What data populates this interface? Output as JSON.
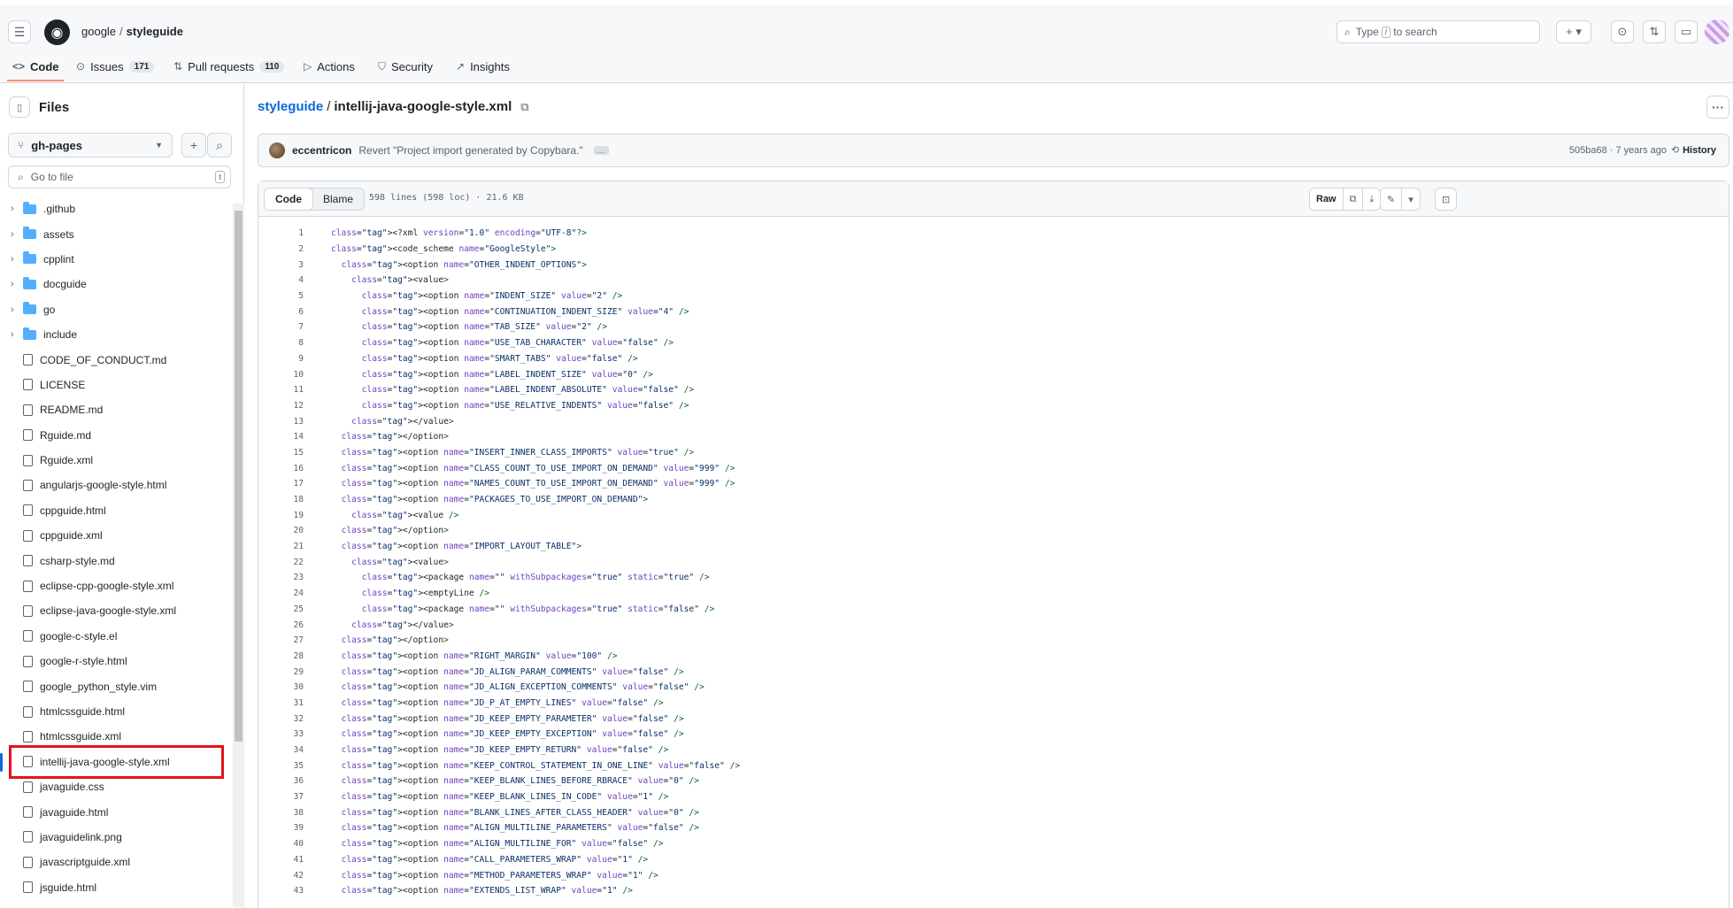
{
  "header": {
    "owner": "google",
    "repo": "styleguide",
    "search_prefix": "Type",
    "search_kbd": "/",
    "search_suffix": "to search"
  },
  "nav_tabs": [
    {
      "icon": "code-icon",
      "label": "Code",
      "count": ""
    },
    {
      "icon": "issue-icon",
      "label": "Issues",
      "count": "171"
    },
    {
      "icon": "pull-request-icon",
      "label": "Pull requests",
      "count": "110"
    },
    {
      "icon": "actions-icon",
      "label": "Actions",
      "count": ""
    },
    {
      "icon": "shield-icon",
      "label": "Security",
      "count": ""
    },
    {
      "icon": "graph-icon",
      "label": "Insights",
      "count": ""
    }
  ],
  "sidebar": {
    "title": "Files",
    "branch": "gh-pages",
    "goto_placeholder": "Go to file",
    "goto_kbd": "t",
    "items": [
      {
        "type": "folder",
        "name": ".github"
      },
      {
        "type": "folder",
        "name": "assets"
      },
      {
        "type": "folder",
        "name": "cpplint"
      },
      {
        "type": "folder",
        "name": "docguide"
      },
      {
        "type": "folder",
        "name": "go"
      },
      {
        "type": "folder",
        "name": "include"
      },
      {
        "type": "file",
        "name": "CODE_OF_CONDUCT.md"
      },
      {
        "type": "file",
        "name": "LICENSE"
      },
      {
        "type": "file",
        "name": "README.md"
      },
      {
        "type": "file",
        "name": "Rguide.md"
      },
      {
        "type": "file",
        "name": "Rguide.xml"
      },
      {
        "type": "file",
        "name": "angularjs-google-style.html"
      },
      {
        "type": "file",
        "name": "cppguide.html"
      },
      {
        "type": "file",
        "name": "cppguide.xml"
      },
      {
        "type": "file",
        "name": "csharp-style.md"
      },
      {
        "type": "file",
        "name": "eclipse-cpp-google-style.xml"
      },
      {
        "type": "file",
        "name": "eclipse-java-google-style.xml"
      },
      {
        "type": "file",
        "name": "google-c-style.el"
      },
      {
        "type": "file",
        "name": "google-r-style.html"
      },
      {
        "type": "file",
        "name": "google_python_style.vim"
      },
      {
        "type": "file",
        "name": "htmlcssguide.html"
      },
      {
        "type": "file",
        "name": "htmlcssguide.xml"
      },
      {
        "type": "file",
        "name": "intellij-java-google-style.xml",
        "selected": true
      },
      {
        "type": "file",
        "name": "javaguide.css"
      },
      {
        "type": "file",
        "name": "javaguide.html"
      },
      {
        "type": "file",
        "name": "javaguidelink.png"
      },
      {
        "type": "file",
        "name": "javascriptguide.xml"
      },
      {
        "type": "file",
        "name": "jsguide.html"
      }
    ]
  },
  "breadcrumb": {
    "repo_link": "styleguide",
    "separator": "/",
    "file": "intellij-java-google-style.xml"
  },
  "commit": {
    "author": "eccentricon",
    "message": "Revert \"Project import generated by Copybara.\"",
    "ellipsis": "…",
    "meta": "505ba68 · 7 years ago",
    "history_label": "History"
  },
  "code_toolbar": {
    "code_label": "Code",
    "blame_label": "Blame",
    "info": "598 lines (598 loc) · 21.6 KB",
    "raw_label": "Raw"
  },
  "code_lines": [
    "<?xml version=\"1.0\" encoding=\"UTF-8\"?>",
    "<code_scheme name=\"GoogleStyle\">",
    "  <option name=\"OTHER_INDENT_OPTIONS\">",
    "    <value>",
    "      <option name=\"INDENT_SIZE\" value=\"2\" />",
    "      <option name=\"CONTINUATION_INDENT_SIZE\" value=\"4\" />",
    "      <option name=\"TAB_SIZE\" value=\"2\" />",
    "      <option name=\"USE_TAB_CHARACTER\" value=\"false\" />",
    "      <option name=\"SMART_TABS\" value=\"false\" />",
    "      <option name=\"LABEL_INDENT_SIZE\" value=\"0\" />",
    "      <option name=\"LABEL_INDENT_ABSOLUTE\" value=\"false\" />",
    "      <option name=\"USE_RELATIVE_INDENTS\" value=\"false\" />",
    "    </value>",
    "  </option>",
    "  <option name=\"INSERT_INNER_CLASS_IMPORTS\" value=\"true\" />",
    "  <option name=\"CLASS_COUNT_TO_USE_IMPORT_ON_DEMAND\" value=\"999\" />",
    "  <option name=\"NAMES_COUNT_TO_USE_IMPORT_ON_DEMAND\" value=\"999\" />",
    "  <option name=\"PACKAGES_TO_USE_IMPORT_ON_DEMAND\">",
    "    <value />",
    "  </option>",
    "  <option name=\"IMPORT_LAYOUT_TABLE\">",
    "    <value>",
    "      <package name=\"\" withSubpackages=\"true\" static=\"true\" />",
    "      <emptyLine />",
    "      <package name=\"\" withSubpackages=\"true\" static=\"false\" />",
    "    </value>",
    "  </option>",
    "  <option name=\"RIGHT_MARGIN\" value=\"100\" />",
    "  <option name=\"JD_ALIGN_PARAM_COMMENTS\" value=\"false\" />",
    "  <option name=\"JD_ALIGN_EXCEPTION_COMMENTS\" value=\"false\" />",
    "  <option name=\"JD_P_AT_EMPTY_LINES\" value=\"false\" />",
    "  <option name=\"JD_KEEP_EMPTY_PARAMETER\" value=\"false\" />",
    "  <option name=\"JD_KEEP_EMPTY_EXCEPTION\" value=\"false\" />",
    "  <option name=\"JD_KEEP_EMPTY_RETURN\" value=\"false\" />",
    "  <option name=\"KEEP_CONTROL_STATEMENT_IN_ONE_LINE\" value=\"false\" />",
    "  <option name=\"KEEP_BLANK_LINES_BEFORE_RBRACE\" value=\"0\" />",
    "  <option name=\"KEEP_BLANK_LINES_IN_CODE\" value=\"1\" />",
    "  <option name=\"BLANK_LINES_AFTER_CLASS_HEADER\" value=\"0\" />",
    "  <option name=\"ALIGN_MULTILINE_PARAMETERS\" value=\"false\" />",
    "  <option name=\"ALIGN_MULTILINE_FOR\" value=\"false\" />",
    "  <option name=\"CALL_PARAMETERS_WRAP\" value=\"1\" />",
    "  <option name=\"METHOD_PARAMETERS_WRAP\" value=\"1\" />",
    "  <option name=\"EXTENDS_LIST_WRAP\" value=\"1\" />"
  ]
}
